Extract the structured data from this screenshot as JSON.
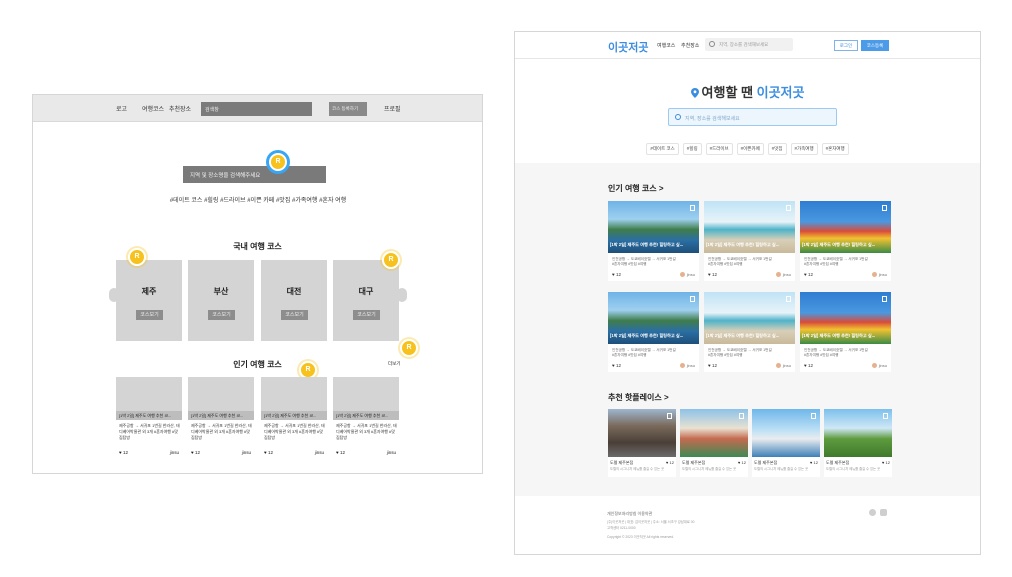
{
  "wireframe": {
    "nav": {
      "logo": "로고",
      "courses": "여행코스",
      "places": "추천장소",
      "search": "검색창",
      "register": "코스 등록하기",
      "profile": "프로필"
    },
    "hero_placeholder": "지역 및 장소명을 검색해주세요",
    "tags": "#데이트 코스 #힐링 #드라이브 #이쁜 카페 #맛집 #가족여행 #혼자 여행",
    "pin_label": "R",
    "domestic_title": "국내 여행 코스",
    "regions": [
      {
        "name": "제주",
        "button": "코스보기"
      },
      {
        "name": "부산",
        "button": "코스보기"
      },
      {
        "name": "대전",
        "button": "코스보기"
      },
      {
        "name": "대구",
        "button": "코스보기"
      }
    ],
    "popular_title": "인기 여행 코스",
    "more": "더보기",
    "cards": [
      {
        "title": "[1박 2일] 제주도 여행 추천 코...",
        "desc": "제주공항 → 서귀포 1번길 한라산, 태디베어박물관 외 3개 #혼자여행 #맛집탐방",
        "likes": "12",
        "user": "jinsu"
      },
      {
        "title": "[1박 2일] 제주도 여행 추천 코...",
        "desc": "제주공항 → 서귀포 1번길 한라산, 태디베어박물관 외 3개 #혼자여행 #맛집탐방",
        "likes": "12",
        "user": "jinsu"
      },
      {
        "title": "[1박 2일] 제주도 여행 추천 코...",
        "desc": "제주공항 → 서귀포 1번길 한라산, 태디베어박물관 외 3개 #혼자여행 #맛집탐방",
        "likes": "12",
        "user": "jinsu"
      },
      {
        "title": "[1박 2일] 제주도 여행 추천 코...",
        "desc": "제주공항 → 서귀포 1번길 한라산, 태디베어박물관 외 3개 #혼자여행 #맛집탐방",
        "likes": "12",
        "user": "jinsu"
      }
    ]
  },
  "design": {
    "logo": "이곳저곳",
    "nav": {
      "courses": "여행코스",
      "places": "추천장소"
    },
    "search_placeholder": "지역, 장소를 검색해보세요",
    "login": "로그인",
    "register": "코스등록",
    "hero_prefix": "여행할 땐 ",
    "hero_brand": "이곳저곳",
    "hero_placeholder": "지역, 장소를 검색해보세요",
    "tags": [
      "#데이트 코스",
      "#힐링",
      "#드라이브",
      "#이쁜카페",
      "#맛집",
      "#가족여행",
      "#혼자여행"
    ],
    "popular_title": "인기 여행 코스 >",
    "course_cards": [
      {
        "title": "[1박 2일] 제주도 여행 추천! 힐링하고 싶...",
        "route": "인천공항 → 도쿄베이호텔 → 서귀포 1번길",
        "tags": "#혼자여행 #맛집 #여행",
        "likes": "12",
        "user": "jinsu",
        "theme": "sea"
      },
      {
        "title": "[1박 2일] 제주도 여행 추천! 힐링하고 싶...",
        "route": "인천공항 → 도쿄베이호텔 → 서귀포 1번길",
        "tags": "#혼자여행 #맛집 #여행",
        "likes": "12",
        "user": "jinsu",
        "theme": "beach"
      },
      {
        "title": "[1박 2일] 제주도 여행 추천! 힐링하고 싶...",
        "route": "인천공항 → 도쿄베이호텔 → 서귀포 1번길",
        "tags": "#혼자여행 #맛집 #여행",
        "likes": "12",
        "user": "jinsu",
        "theme": "lego"
      },
      {
        "title": "[1박 2일] 제주도 여행 추천! 힐링하고 싶...",
        "route": "인천공항 → 도쿄베이호텔 → 서귀포 1번길",
        "tags": "#혼자여행 #맛집 #여행",
        "likes": "12",
        "user": "jinsu",
        "theme": "sea"
      },
      {
        "title": "[1박 2일] 제주도 여행 추천! 힐링하고 싶...",
        "route": "인천공항 → 도쿄베이호텔 → 서귀포 1번길",
        "tags": "#혼자여행 #맛집 #여행",
        "likes": "12",
        "user": "jinsu",
        "theme": "beach"
      },
      {
        "title": "[1박 2일] 제주도 여행 추천! 힐링하고 싶...",
        "route": "인천공항 → 도쿄베이호텔 → 서귀포 1번길",
        "tags": "#혼자여행 #맛집 #여행",
        "likes": "12",
        "user": "jinsu",
        "theme": "lego"
      }
    ],
    "hotplace_title": "추천 핫플레이스 >",
    "hotplaces": [
      {
        "name": "도렐 제주본점",
        "likes": "12",
        "desc": "도렐의 시그니처 메뉴를 즐길 수 있는 곳",
        "theme": "cafe"
      },
      {
        "name": "도렐 제주본점",
        "likes": "12",
        "desc": "도렐의 시그니처 메뉴를 즐길 수 있는 곳",
        "theme": "town"
      },
      {
        "name": "도렐 제주본점",
        "likes": "12",
        "desc": "도렐의 시그니처 메뉴를 즐길 수 있는 곳",
        "theme": "harbor"
      },
      {
        "name": "도렐 제주본점",
        "likes": "12",
        "desc": "도렐의 시그니처 메뉴를 즐길 수 있는 곳",
        "theme": "hill"
      }
    ],
    "footer": {
      "links": "개인정보처리방침    이용약관",
      "info1": "(주)이곳저곳 | 대표: 김이곳저곳 | 주소: 서울 서초구 강남대로 00",
      "info2": "고객센터 0211-0000",
      "copyright": "Copyright © 2023 이곳저곳 All rights reserved."
    }
  },
  "colors": {
    "brand": "#3b8de0",
    "pin": "#f7c21d",
    "wire_gray": "#d4d4d4"
  }
}
